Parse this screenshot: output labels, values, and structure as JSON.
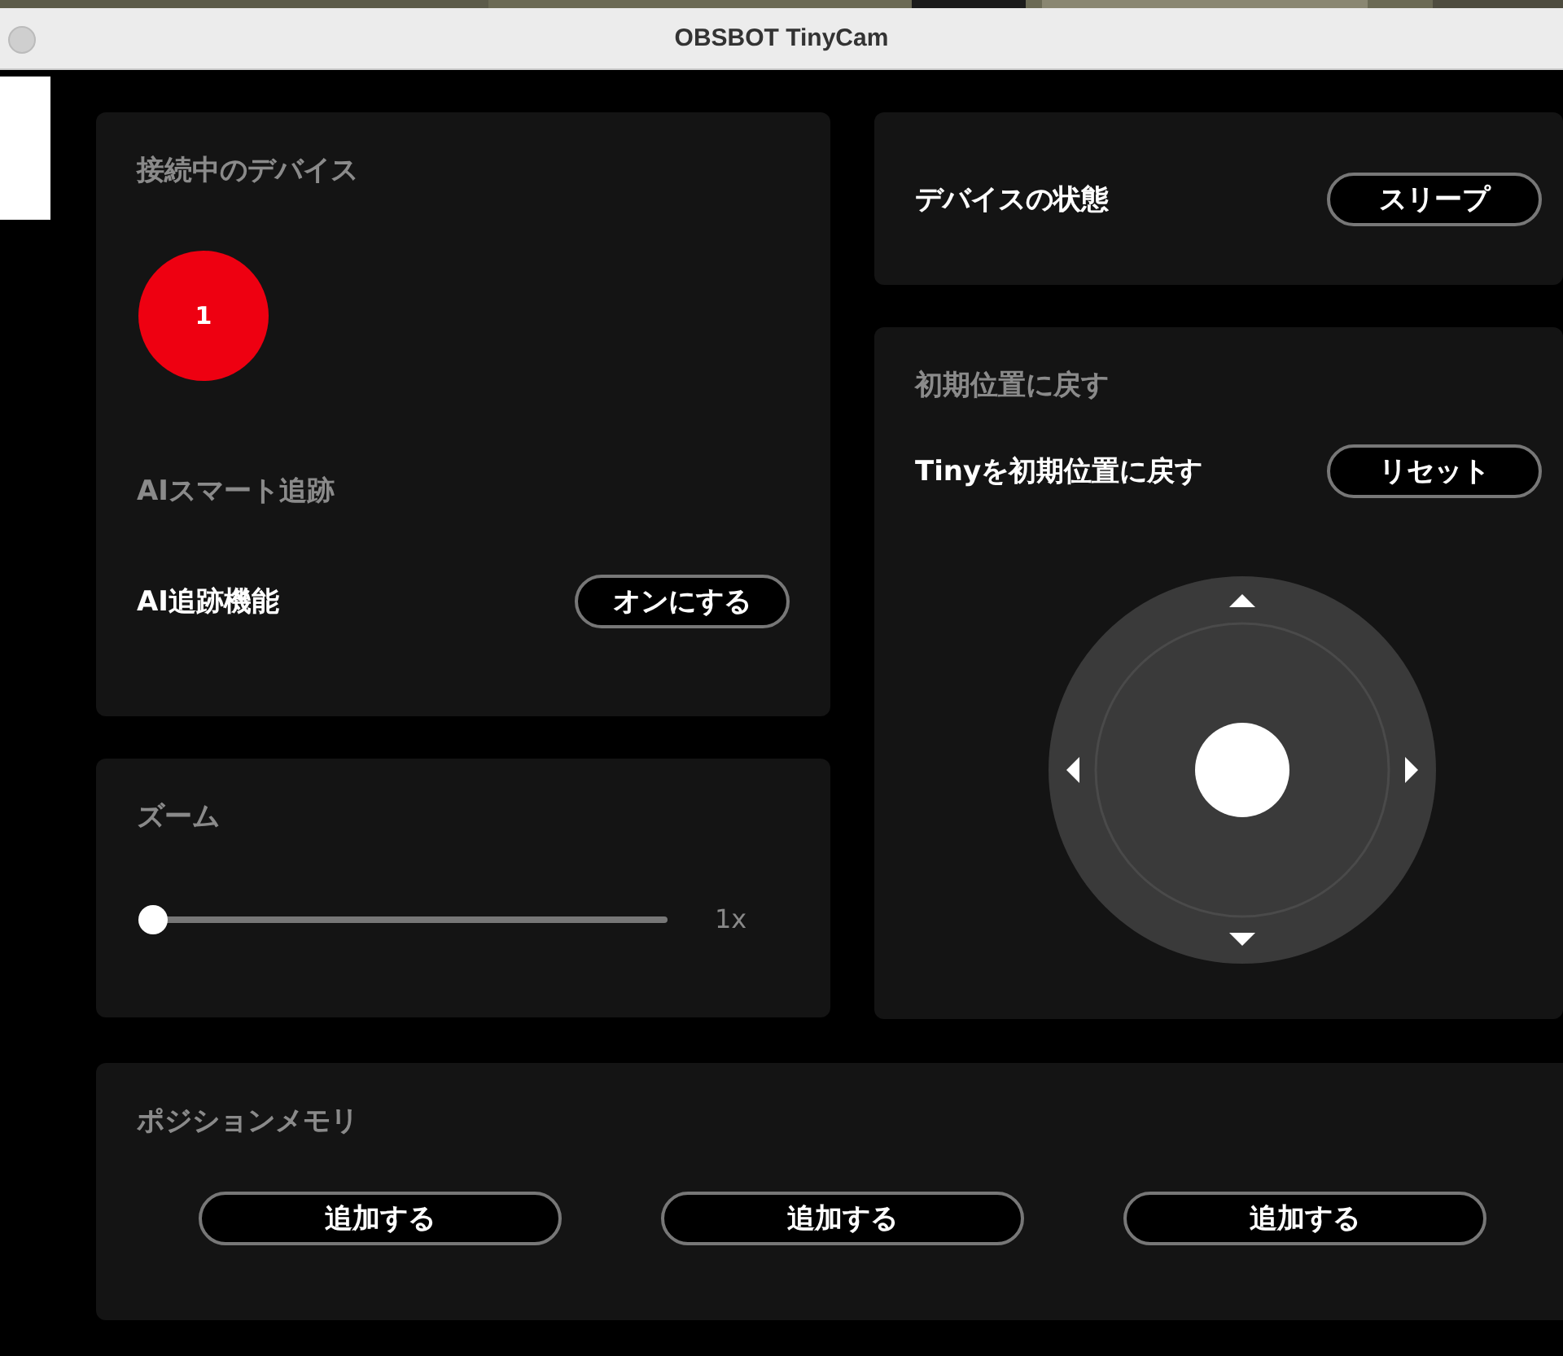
{
  "window": {
    "title": "OBSBOT TinyCam"
  },
  "connected_devices": {
    "heading": "接続中のデバイス",
    "devices": [
      {
        "label": "1"
      }
    ]
  },
  "ai_tracking": {
    "heading": "AIスマート追跡",
    "label": "AI追跡機能",
    "button": "オンにする"
  },
  "zoom": {
    "heading": "ズーム",
    "level": 0,
    "reading": "1x"
  },
  "device_status": {
    "label": "デバイスの状態",
    "button": "スリープ"
  },
  "reset": {
    "heading": "初期位置に戻す",
    "label": "Tinyを初期位置に戻す",
    "button": "リセット"
  },
  "position_memory": {
    "heading": "ポジションメモリ",
    "buttons": [
      "追加する",
      "追加する",
      "追加する"
    ]
  }
}
